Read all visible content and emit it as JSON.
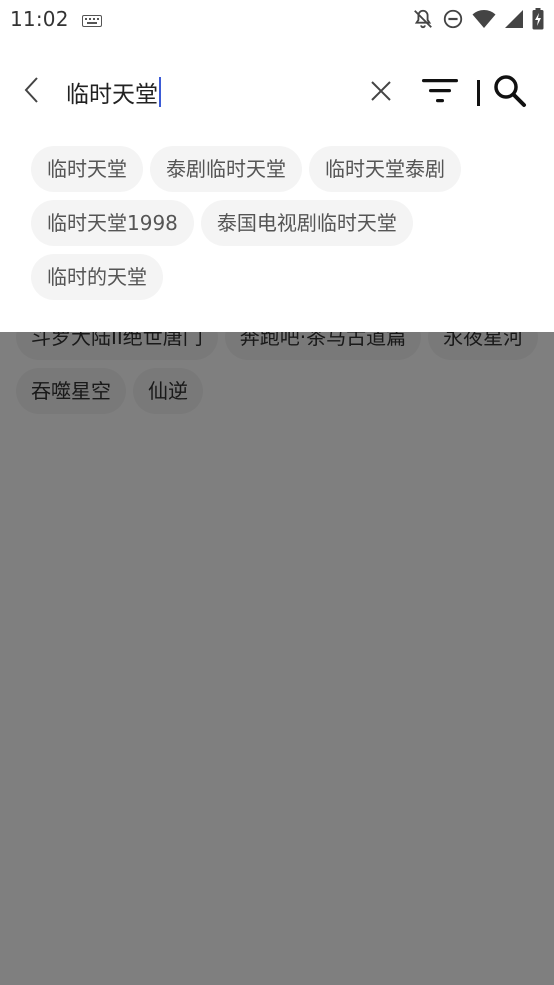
{
  "status_bar": {
    "time": "11:02"
  },
  "icons": {
    "keyboard": "keyboard-icon",
    "notifications_off": "bell-off-icon",
    "do_not_disturb": "do-not-disturb-icon",
    "wifi": "wifi-icon",
    "signal": "signal-icon",
    "battery": "battery-charging-icon",
    "back": "chevron-left-icon",
    "clear": "close-icon",
    "filter": "filter-icon",
    "search": "search-icon"
  },
  "search": {
    "value": "临时天堂"
  },
  "suggestions": [
    "临时天堂",
    "泰剧临时天堂",
    "临时天堂泰剧",
    "临时天堂1998",
    "泰国电视剧临时天堂",
    "临时的天堂"
  ],
  "background_chips": [
    "斗罗大陆II绝世唐门",
    "奔跑吧·茶马古道篇",
    "永夜星河",
    "吞噬星空",
    "仙逆"
  ],
  "colors": {
    "overlay": "#808080",
    "caret": "#3b5bd6",
    "chip_bg": "#f4f4f4"
  }
}
